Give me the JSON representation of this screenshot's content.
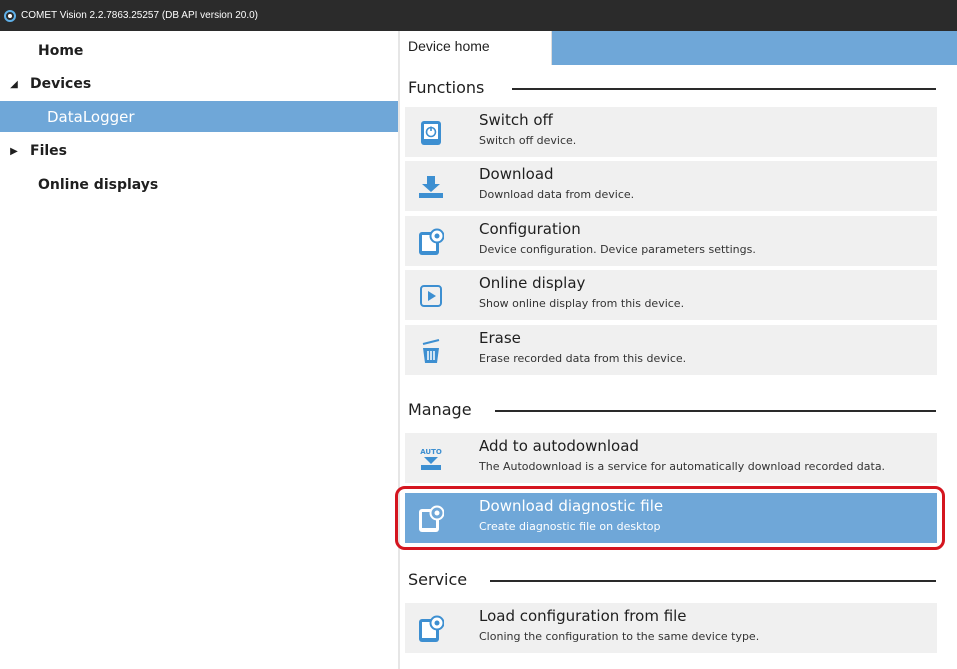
{
  "window": {
    "title": "COMET Vision 2.2.7863.25257 (DB API version 20.0)"
  },
  "sidebar": {
    "home": "Home",
    "devices": "Devices",
    "datalogger": "DataLogger",
    "files": "Files",
    "online_displays": "Online displays"
  },
  "tab": {
    "label": "Device home"
  },
  "sections": {
    "functions": "Functions",
    "manage": "Manage",
    "service": "Service"
  },
  "functions": [
    {
      "label": "Switch off",
      "desc": "Switch off device.",
      "icon": "power-icon"
    },
    {
      "label": "Download",
      "desc": "Download data from device.",
      "icon": "download-icon"
    },
    {
      "label": "Configuration",
      "desc": "Device configuration. Device parameters settings.",
      "icon": "configuration-icon"
    },
    {
      "label": "Online display",
      "desc": "Show online display from this device.",
      "icon": "play-icon"
    },
    {
      "label": "Erase",
      "desc": "Erase recorded data from this device.",
      "icon": "trash-icon"
    }
  ],
  "manage": [
    {
      "label": "Add to autodownload",
      "desc": "The Autodownload is a service for automatically download recorded data.",
      "icon": "auto-download-icon",
      "icon_text": "AUTO"
    },
    {
      "label": "Download diagnostic file",
      "desc": "Create diagnostic file on desktop",
      "icon": "configuration-icon"
    }
  ],
  "service": [
    {
      "label": "Load configuration from file",
      "desc": "Cloning the configuration to the same device type.",
      "icon": "configuration-icon"
    }
  ],
  "colors": {
    "accent": "#6fa7d8",
    "highlight": "#d4151f",
    "icon_blue": "#3d8fd1"
  }
}
